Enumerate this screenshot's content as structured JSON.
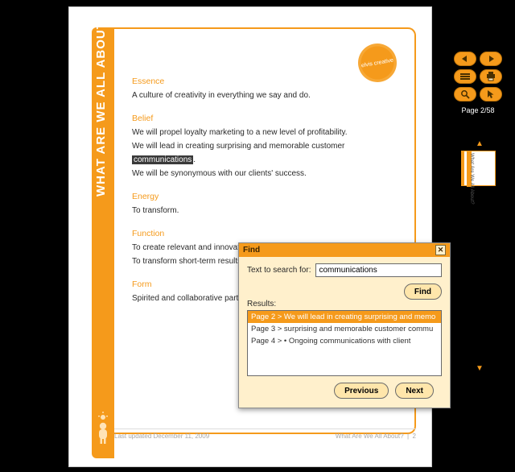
{
  "sidebar": {
    "title": "WHAT ARE WE ALL ABOUT?"
  },
  "stamp_text": "elvis creative",
  "page": {
    "sections": [
      {
        "heading": "Essence",
        "lines": [
          "A culture of creativity in everything we say and do."
        ]
      },
      {
        "heading": "Belief",
        "lines": [
          "We will propel loyalty marketing to a new level of profitability.",
          "We will lead in creating surprising and memorable customer {hl}communications{/hl}.",
          "We will be synonymous with our clients' success."
        ]
      },
      {
        "heading": "Energy",
        "lines": [
          "To transform."
        ]
      },
      {
        "heading": "Function",
        "lines": [
          "To create relevant and innovative strategic insight.",
          "To transform short-term results into"
        ]
      },
      {
        "heading": "Form",
        "lines": [
          "Spirited and collaborative partnership."
        ]
      }
    ]
  },
  "footer": {
    "left": "Last updated December 11, 2009",
    "right_label": "What Are We All About?",
    "sep": "|",
    "pagenum": "2"
  },
  "toolbar": {
    "page_indicator": "Page 2/58"
  },
  "thumb": {
    "caption": "What Are We All About?"
  },
  "find": {
    "title": "Find",
    "search_label": "Text to search for:",
    "search_value": "communications",
    "find_button": "Find",
    "results_label": "Results:",
    "results": [
      "Page 2 > We will lead in creating surprising and memo",
      "Page 3 > surprising and memorable customer commu",
      "Page 4 > • Ongoing communications with client"
    ],
    "prev": "Previous",
    "next": "Next"
  }
}
